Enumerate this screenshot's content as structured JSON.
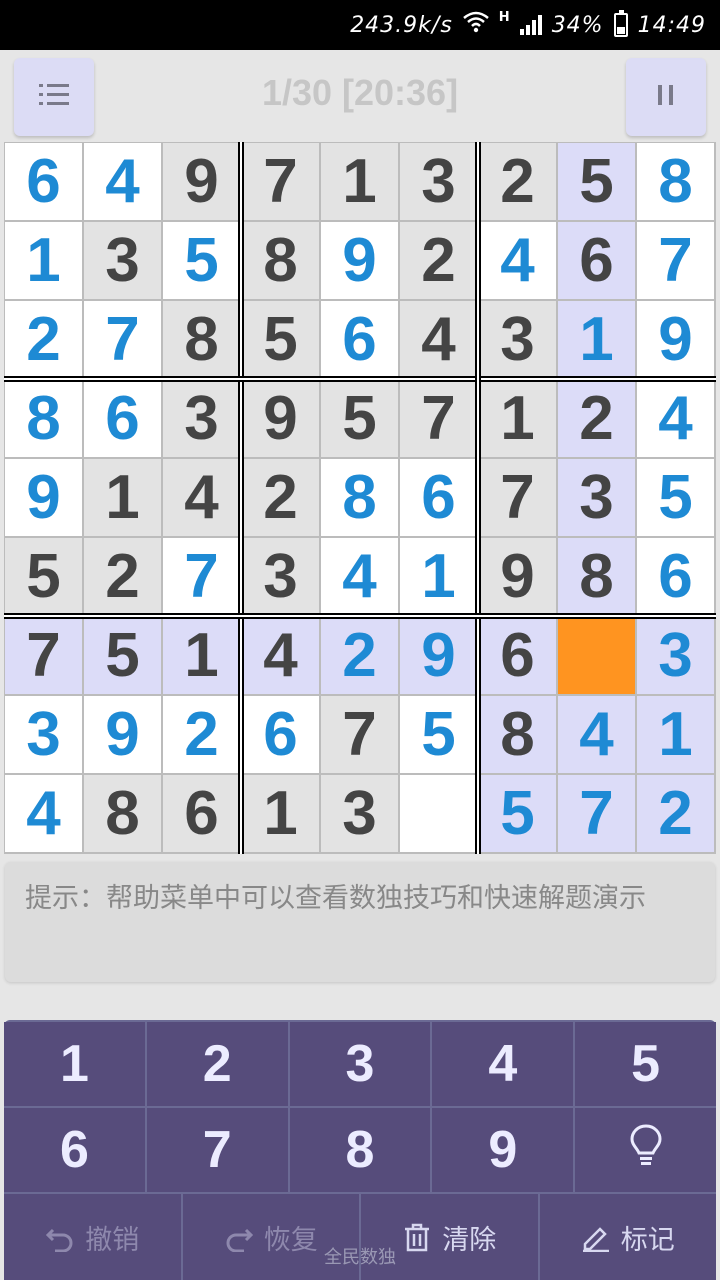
{
  "status_bar": {
    "net_speed": "243.9k/s",
    "network_type": "H",
    "battery": "34%",
    "time": "14:49"
  },
  "header": {
    "title": "1/30 [20:36]",
    "menu_icon": "list-icon",
    "pause_icon": "pause-icon"
  },
  "board": {
    "cells": [
      [
        "6",
        "4",
        "9",
        "7",
        "1",
        "3",
        "2",
        "5",
        "8"
      ],
      [
        "1",
        "3",
        "5",
        "8",
        "9",
        "2",
        "4",
        "6",
        "7"
      ],
      [
        "2",
        "7",
        "8",
        "5",
        "6",
        "4",
        "3",
        "1",
        "9"
      ],
      [
        "8",
        "6",
        "3",
        "9",
        "5",
        "7",
        "1",
        "2",
        "4"
      ],
      [
        "9",
        "1",
        "4",
        "2",
        "8",
        "6",
        "7",
        "3",
        "5"
      ],
      [
        "5",
        "2",
        "7",
        "3",
        "4",
        "1",
        "9",
        "8",
        "6"
      ],
      [
        "7",
        "5",
        "1",
        "4",
        "2",
        "9",
        "6",
        "",
        "3"
      ],
      [
        "3",
        "9",
        "2",
        "6",
        "7",
        "5",
        "8",
        "4",
        "1"
      ],
      [
        "4",
        "8",
        "6",
        "1",
        "3",
        "",
        "5",
        "7",
        "2"
      ]
    ],
    "kinds": [
      [
        "u",
        "u",
        "g",
        "g",
        "g",
        "g",
        "g",
        "g",
        "u"
      ],
      [
        "u",
        "g",
        "u",
        "g",
        "u",
        "g",
        "u",
        "g",
        "u"
      ],
      [
        "u",
        "u",
        "g",
        "g",
        "u",
        "g",
        "g",
        "u",
        "u"
      ],
      [
        "u",
        "u",
        "g",
        "g",
        "g",
        "g",
        "g",
        "g",
        "u"
      ],
      [
        "u",
        "g",
        "g",
        "g",
        "u",
        "u",
        "g",
        "g",
        "u"
      ],
      [
        "g",
        "g",
        "u",
        "g",
        "u",
        "u",
        "g",
        "g",
        "u"
      ],
      [
        "g",
        "g",
        "g",
        "g",
        "u",
        "u",
        "g",
        "s",
        "u"
      ],
      [
        "u",
        "u",
        "u",
        "u",
        "g",
        "u",
        "g",
        "u",
        "u"
      ],
      [
        "u",
        "g",
        "g",
        "g",
        "g",
        "u",
        "u",
        "u",
        "u"
      ]
    ],
    "backgrounds": [
      [
        "w",
        "w",
        "g",
        "g",
        "g",
        "g",
        "g",
        "l",
        "w"
      ],
      [
        "w",
        "g",
        "w",
        "g",
        "w",
        "g",
        "w",
        "l",
        "w"
      ],
      [
        "w",
        "w",
        "g",
        "g",
        "w",
        "g",
        "g",
        "l",
        "w"
      ],
      [
        "w",
        "w",
        "g",
        "g",
        "g",
        "g",
        "g",
        "l",
        "w"
      ],
      [
        "w",
        "g",
        "g",
        "g",
        "w",
        "w",
        "g",
        "l",
        "w"
      ],
      [
        "g",
        "g",
        "w",
        "g",
        "w",
        "w",
        "g",
        "l",
        "w"
      ],
      [
        "l",
        "l",
        "l",
        "l",
        "l",
        "l",
        "l",
        "o",
        "l"
      ],
      [
        "w",
        "w",
        "w",
        "w",
        "g",
        "w",
        "l",
        "l",
        "l"
      ],
      [
        "w",
        "g",
        "g",
        "g",
        "g",
        "w",
        "l",
        "l",
        "l"
      ]
    ],
    "colors": {
      "white": "#ffffff",
      "gray": "#e3e3e3",
      "highlight": "#dcdcf8",
      "selected": "#ff9420",
      "given_text": "#444444",
      "user_text": "#1e8ad4"
    }
  },
  "hint": {
    "text": "提示：帮助菜单中可以查看数独技巧和快速解题演示"
  },
  "keypad": {
    "digits": [
      "1",
      "2",
      "3",
      "4",
      "5",
      "6",
      "7",
      "8",
      "9"
    ],
    "hint_icon": "lightbulb-icon",
    "actions": [
      {
        "label": "撤销",
        "icon": "undo-icon"
      },
      {
        "label": "恢复",
        "icon": "redo-icon"
      },
      {
        "label": "清除",
        "icon": "trash-icon"
      },
      {
        "label": "标记",
        "icon": "pencil-icon"
      }
    ],
    "colors": {
      "key": "#564c7b",
      "grid": "#6b6a94",
      "text": "#ececff"
    }
  },
  "watermark": "全民数独"
}
